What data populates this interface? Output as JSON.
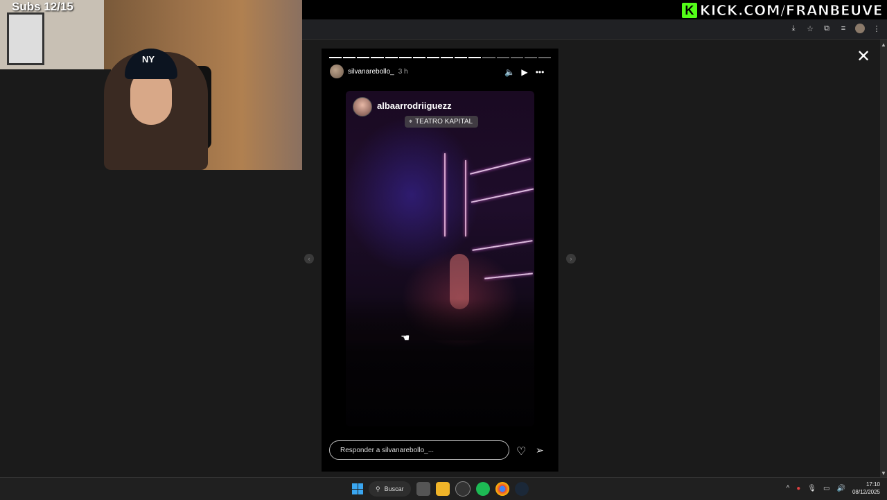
{
  "stream_overlay": {
    "subs_goal": "Subs 12/15",
    "kick_url": "KICK.COM/FRANBEUVE",
    "kick_logo": "K"
  },
  "story": {
    "author": "silvanarebollo_",
    "time_ago": "3 h",
    "progress": {
      "total_segments": 16,
      "completed_segments": 11
    },
    "tagged_user": "albaarrodriiguezz",
    "location": "TEATRO KAPITAL",
    "reply_placeholder": "Responder a silvanarebollo_..."
  },
  "taskbar": {
    "search_label": "Buscar",
    "time": "17:10",
    "date": "08/12/2025"
  },
  "icons": {
    "close": "✕",
    "volume": "🔈",
    "play": "▶",
    "more": "•••",
    "prev": "‹",
    "next": "›",
    "heart": "♡",
    "send": "➢",
    "pin": "⌖",
    "search": "⚲",
    "cursor": "☚"
  }
}
